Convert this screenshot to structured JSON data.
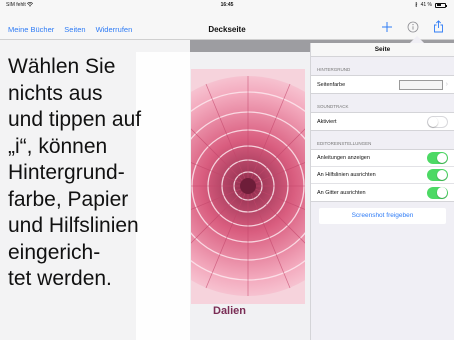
{
  "status_bar": {
    "carrier": "SIM fehlt ",
    "time": "16:45",
    "battery": "41 %"
  },
  "nav": {
    "left_items": [
      "Meine Bücher",
      "Seiten",
      "Widerrufen"
    ],
    "title": "Deckseite",
    "icons": [
      "plus-icon",
      "info-icon",
      "share-icon"
    ]
  },
  "document": {
    "caption": "Dalien"
  },
  "overlay_text": {
    "lines": [
      "Wählen Sie",
      "nichts aus",
      "und tippen auf",
      "„i“, können",
      "Hintergrund-",
      "farbe, Papier",
      "und Hilfslinien",
      "eingerich-",
      "tet werden."
    ]
  },
  "panel": {
    "title": "Seite",
    "sections": [
      {
        "header": "Hintergrund",
        "rows": [
          {
            "label": "Seitenfarbe",
            "control": "swatch"
          }
        ]
      },
      {
        "header": "Soundtrack",
        "rows": [
          {
            "label": "Aktiviert",
            "control": "toggle",
            "on": false
          }
        ]
      },
      {
        "header": "Editoreinstellungen",
        "rows": [
          {
            "label": "Anleitungen anzeigen",
            "control": "toggle",
            "on": true
          },
          {
            "label": "An Hilfslinien ausrichten",
            "control": "toggle",
            "on": true
          },
          {
            "label": "An Gitter ausrichten",
            "control": "toggle",
            "on": true
          }
        ]
      }
    ],
    "share_button": "Screenshot freigeben"
  },
  "colors": {
    "accent": "#2f7cf6",
    "toggle_on": "#4cd964",
    "caption": "#7a2d55"
  }
}
